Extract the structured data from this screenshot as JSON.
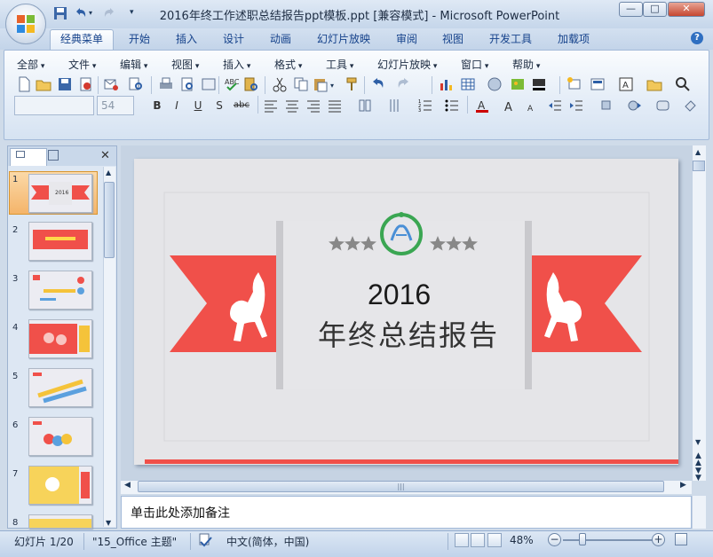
{
  "window": {
    "title": "2016年终工作述职总结报告ppt模板.ppt [兼容模式] - Microsoft PowerPoint",
    "minimize": "—",
    "maximize": "□",
    "close": "✕"
  },
  "tabs": [
    "经典菜单",
    "开始",
    "插入",
    "设计",
    "动画",
    "幻灯片放映",
    "审阅",
    "视图",
    "开发工具",
    "加载项"
  ],
  "help": "?",
  "menus": [
    "全部",
    "文件",
    "编辑",
    "视图",
    "插入",
    "格式",
    "工具",
    "幻灯片放映",
    "窗口",
    "帮助"
  ],
  "format": {
    "font": "",
    "size": "54",
    "bold": "B",
    "italic": "I",
    "underline": "U",
    "shadow": "S",
    "abc": "abc"
  },
  "slides_panel": {
    "numbers": [
      "1",
      "2",
      "3",
      "4",
      "5",
      "6",
      "7",
      "8"
    ],
    "selected": "1"
  },
  "slide": {
    "year": "2016",
    "subtitle": "年终总结报告",
    "accent": "#f0504a"
  },
  "notes": {
    "placeholder": "单击此处添加备注"
  },
  "status": {
    "slide_count": "幻灯片 1/20",
    "theme": "\"15_Office 主题\"",
    "language": "中文(简体，中国)",
    "zoom": "48%"
  },
  "icons": [
    "office-button",
    "save-icon",
    "undo-icon",
    "redo-icon",
    "new-icon",
    "open-icon",
    "print-icon",
    "cut-icon",
    "copy-icon",
    "paste-icon",
    "chart-icon",
    "table-icon",
    "zoom-icon"
  ]
}
